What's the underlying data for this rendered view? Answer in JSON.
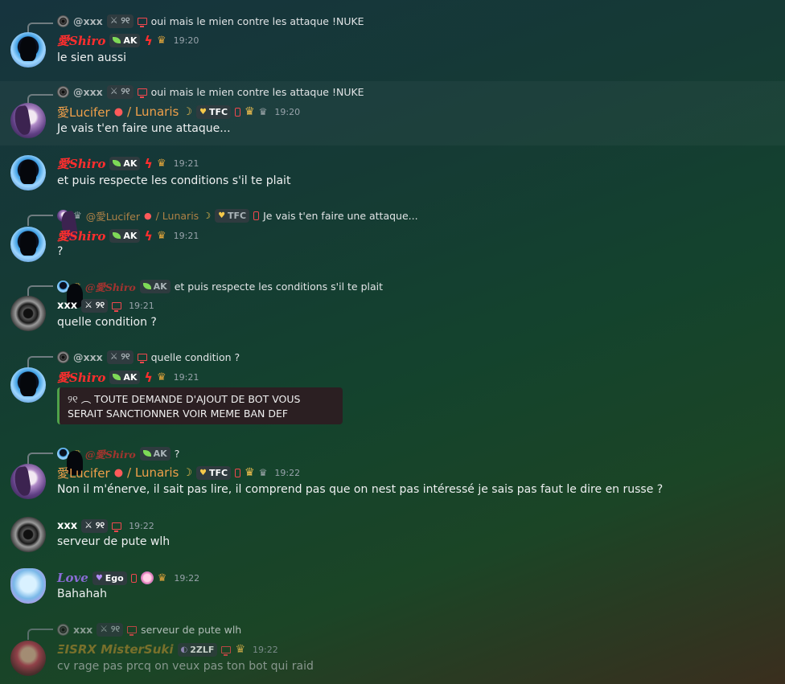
{
  "messages": [
    {
      "reply": {
        "name": "@xxx",
        "text": "oui mais le mien contre les attaque !NUKE"
      },
      "author": "愛Shiro",
      "tag": "AK",
      "time": "19:20",
      "text": "le sien aussi"
    },
    {
      "reply": {
        "name": "@xxx",
        "text": "oui mais le mien contre les attaque !NUKE"
      },
      "author": "愛Lucifer",
      "author_suffix": "/ Lunaris",
      "tag": "TFC",
      "time": "19:20",
      "text": "Je vais t'en faire une attaque..."
    },
    {
      "author": "愛Shiro",
      "tag": "AK",
      "time": "19:21",
      "text": "et puis respecte les conditions s'il te plait"
    },
    {
      "reply": {
        "name": "@愛Lucifer",
        "suffix": "/ Lunaris",
        "tag": "TFC",
        "text": "Je vais t'en faire une attaque..."
      },
      "author": "愛Shiro",
      "tag": "AK",
      "time": "19:21",
      "text": "?"
    },
    {
      "reply": {
        "name": "@愛Shiro",
        "tag": "AK",
        "text": "et puis respecte les conditions s'il te plait"
      },
      "author": "xxx",
      "time": "19:21",
      "text": "quelle condition ?"
    },
    {
      "reply": {
        "name": "@xxx",
        "text": "quelle condition ?"
      },
      "author": "愛Shiro",
      "tag": "AK",
      "time": "19:21",
      "embed": {
        "line1": "୨୧ ︵ TOUTE DEMANDE D'AJOUT DE BOT VOUS",
        "line2": "SERAIT SANCTIONNER VOIR MEME BAN DEF"
      }
    },
    {
      "reply": {
        "name": "@愛Shiro",
        "tag": "AK",
        "text": "?"
      },
      "author": "愛Lucifer",
      "author_suffix": "/ Lunaris",
      "tag": "TFC",
      "time": "19:22",
      "text": "Non il m'énerve, il sait pas lire, il comprend pas que on nest pas intéressé je sais pas faut le dire en russe ?"
    },
    {
      "author": "xxx",
      "time": "19:22",
      "text": "serveur de pute wlh"
    },
    {
      "author": "Love",
      "tag": "Ego",
      "time": "19:22",
      "text": "Bahahah"
    },
    {
      "reply": {
        "name": "xxx",
        "text": "serveur de pute wlh"
      },
      "author": "ΞISRX MisterSuki",
      "tag": "2ZLF",
      "time": "19:22",
      "text": "cv rage pas prcq on veux pas ton bot qui raid"
    }
  ],
  "icons": {
    "leaf": "leaf-icon",
    "crown": "crown-icon",
    "bolt": "lightning-icon",
    "phone": "mobile-icon",
    "monitor": "desktop-icon",
    "apple": "apple-icon",
    "moon": "moon-icon"
  },
  "colors": {
    "shiro": "#ff2e2e",
    "lucifer": "#f0a04a",
    "love": "#8a6cd6",
    "suki": "#c3922f",
    "embed_bar": "#4fa24a"
  }
}
